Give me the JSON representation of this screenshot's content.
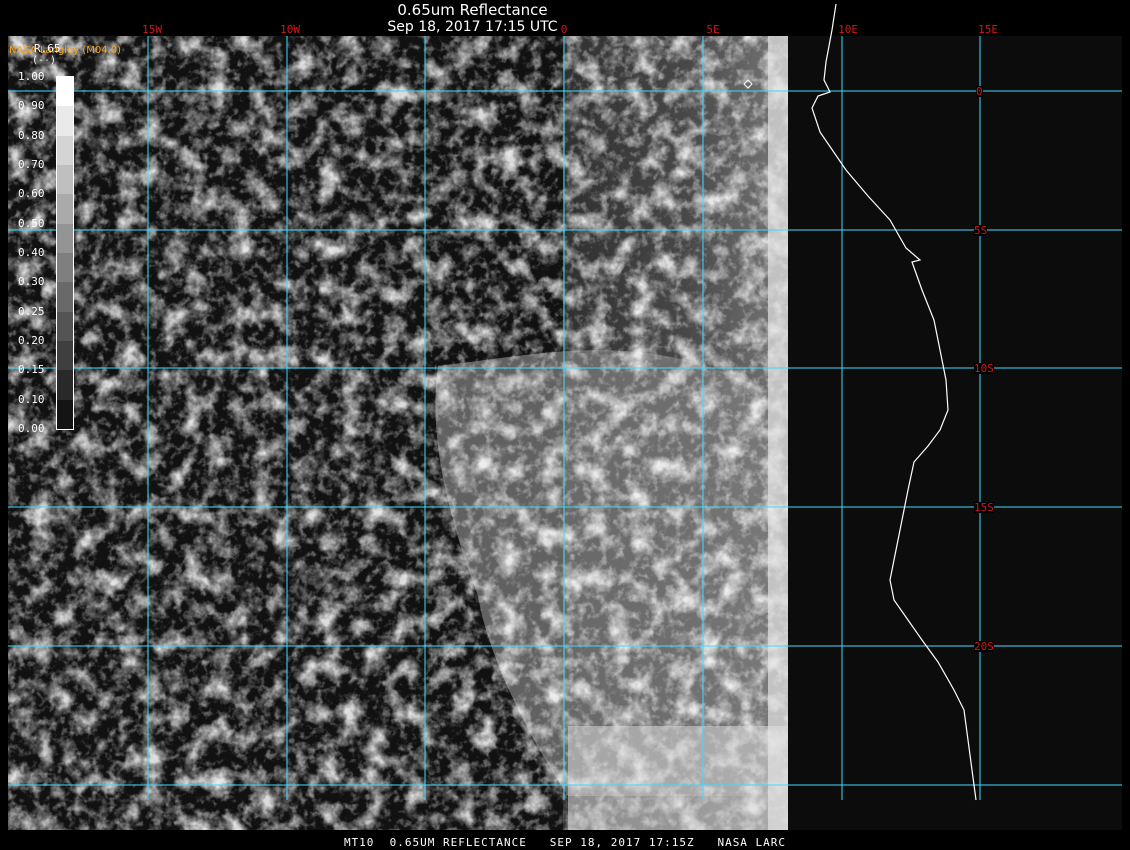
{
  "header": {
    "title": "0.65um Reflectance",
    "subtitle": "Sep 18, 2017 17:15 UTC",
    "source": "NASA Langley (M04.0)"
  },
  "legend": {
    "variable": "R.65",
    "unit": "(--)",
    "ticks": [
      "1.00",
      "0.90",
      "0.80",
      "0.70",
      "0.60",
      "0.50",
      "0.40",
      "0.30",
      "0.25",
      "0.20",
      "0.15",
      "0.10",
      "0.00"
    ]
  },
  "map": {
    "lon_labels": [
      "15W",
      "10W",
      "0",
      "5E",
      "10E",
      "15E"
    ],
    "lat_labels": [
      "0",
      "5S",
      "10S",
      "15S",
      "20S"
    ],
    "grid_color": "#3fd9ff",
    "label_color": "#d01818",
    "coastline_color": "#ffffff"
  },
  "footer": {
    "text": "MT10  0.65UM REFLECTANCE   SEP 18, 2017 17:15Z   NASA LARC"
  }
}
